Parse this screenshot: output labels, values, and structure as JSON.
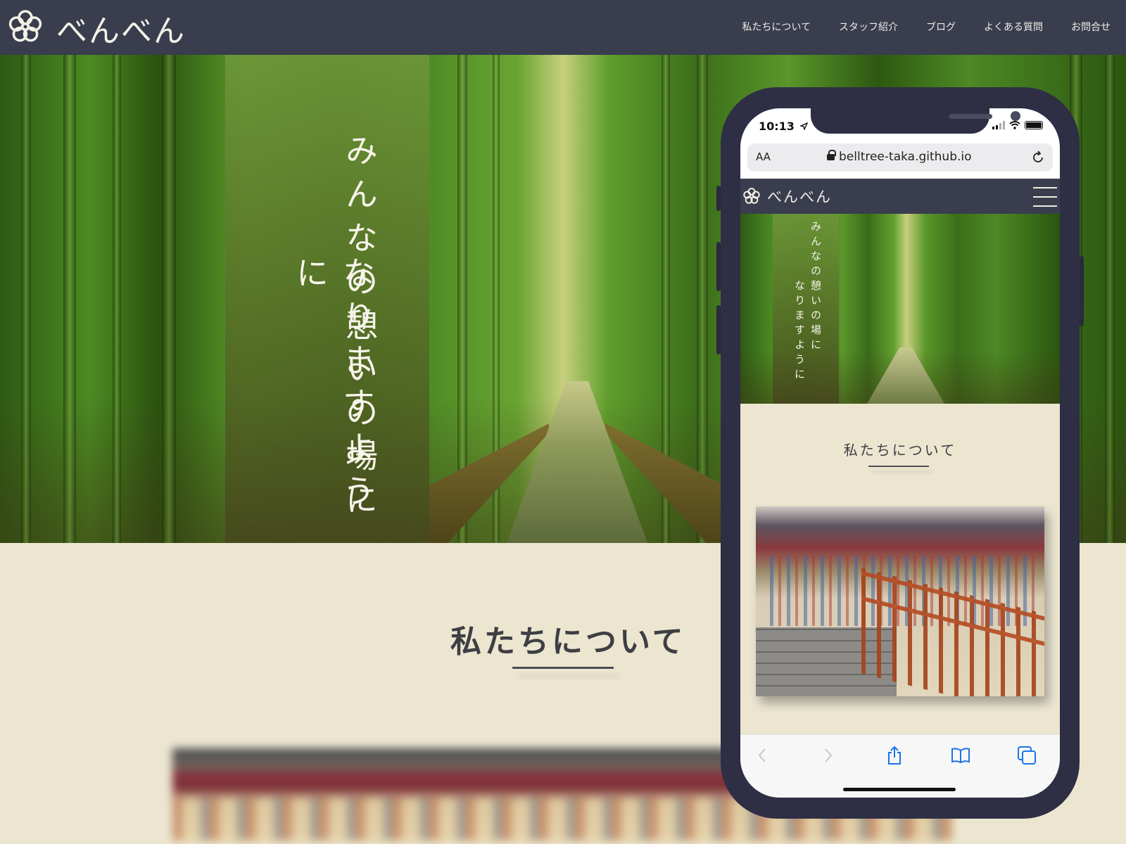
{
  "site": {
    "brand": "べんべん",
    "nav": [
      "私たちについて",
      "スタッフ紹介",
      "ブログ",
      "よくある質問",
      "お問合せ"
    ]
  },
  "hero": {
    "tagline_line1": "みんなの憩いの場に",
    "tagline_line2": "なりますように"
  },
  "about": {
    "title": "私たちについて"
  },
  "phone": {
    "status_time": "10:13",
    "url_aa": "AA",
    "url": "belltree-taka.github.io",
    "brand": "べんべん",
    "tagline_line1": "みんなの憩いの場に",
    "tagline_line2": "なりますように",
    "about_title": "私たちについて"
  },
  "colors": {
    "header_bg": "#393d4e",
    "page_bg": "#ece6d1",
    "phone_frame": "#2e2e45",
    "safari_accent": "#1a73e8"
  },
  "icons": [
    "logo-flower-icon",
    "location-arrow-icon",
    "signal-icon",
    "wifi-icon",
    "battery-icon",
    "lock-icon",
    "reload-icon",
    "hamburger-menu-icon",
    "back-arrow-icon",
    "forward-arrow-icon",
    "share-icon",
    "bookmarks-icon",
    "tabs-icon"
  ]
}
